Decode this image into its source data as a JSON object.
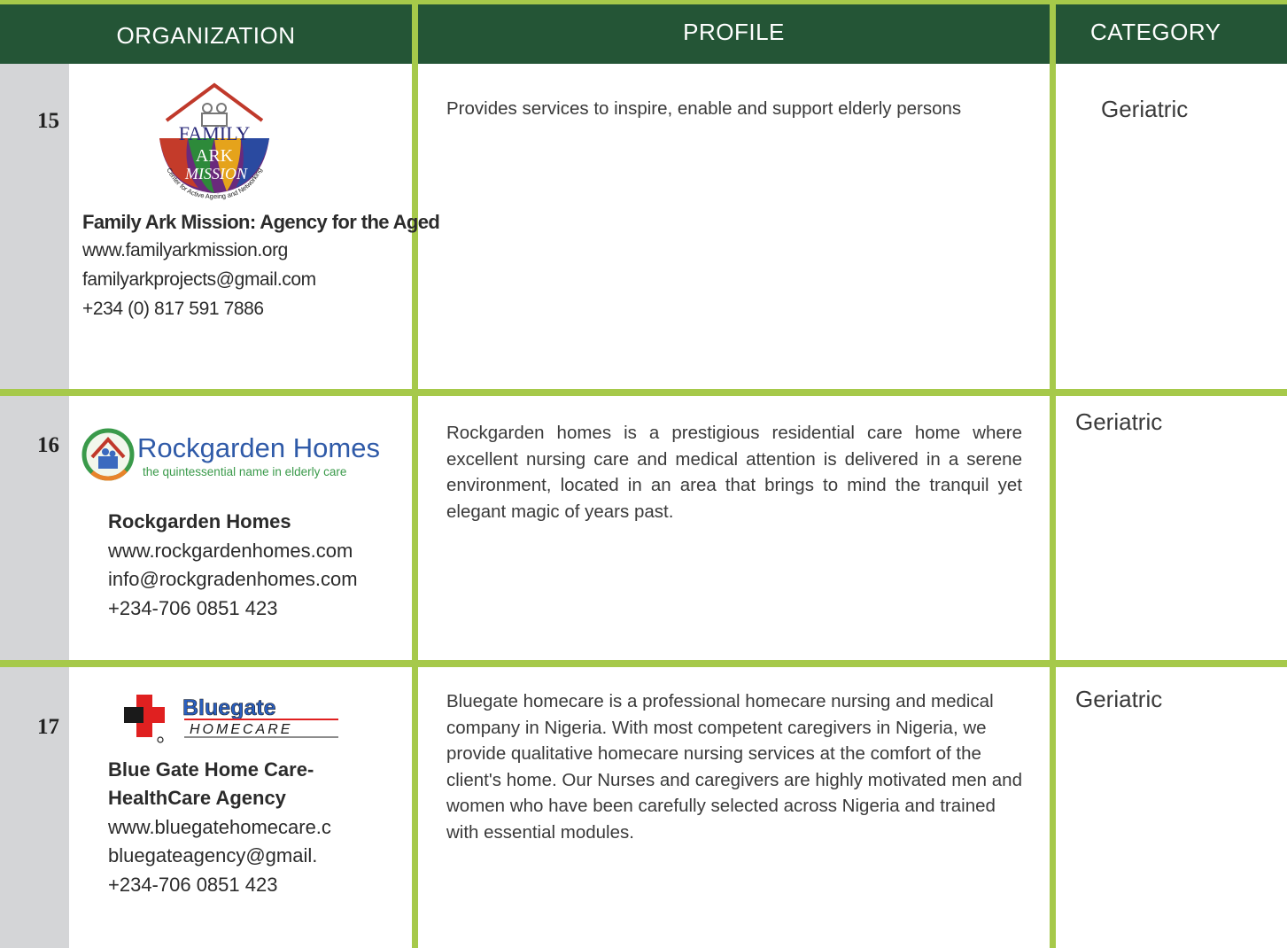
{
  "header": {
    "organization": "ORGANIZATION",
    "profile": "PROFILE",
    "category": "CATEGORY"
  },
  "rows": [
    {
      "number": "15",
      "logo": {
        "icon": "family-ark-mission-logo",
        "line1": "FAMILY",
        "line2": "ARK",
        "line3": "MISSION",
        "arc_text": "Center for Active Ageing and Networking"
      },
      "name": "Family Ark Mission: Agency for the Aged",
      "website": "www.familyarkmission.org",
      "email": "familyarkprojects@gmail.com",
      "phone": "+234 (0) 817 591 7886",
      "profile": "Provides services to inspire, enable and support elderly persons",
      "category": "Geriatric"
    },
    {
      "number": "16",
      "logo": {
        "icon": "rockgarden-homes-logo",
        "title": "Rockgarden Homes",
        "tagline": "the quintessential name in elderly care"
      },
      "name": "Rockgarden Homes",
      "website": "www.rockgardenhomes.com",
      "email": "info@rockgradenhomes.com",
      "phone": "+234-706 0851 423",
      "profile": "Rockgarden homes is a prestigious residential care home where excellent nursing care and medical attention is delivered in a serene environment, located in an area that brings to mind the tranquil yet elegant magic of years past.",
      "category": "Geriatric"
    },
    {
      "number": "17",
      "logo": {
        "icon": "bluegate-homecare-logo",
        "title": "Bluegate",
        "subtitle": "HOMECARE"
      },
      "name_line1": "Blue Gate Home Care-",
      "name_line2": "HealthCare Agency",
      "website": "www.bluegatehomecare.c",
      "email": "bluegateagency@gmail.",
      "phone": "+234-706 0851 423",
      "profile": "Bluegate homecare is a professional homecare nursing and medical company in Nigeria. With most competent caregivers in Nigeria, we provide qualitative homecare nursing services at the comfort of the client's home. Our Nurses and caregivers are highly motivated men and women who have been carefully selected across Nigeria and trained with essential modules.",
      "category": "Geriatric"
    }
  ],
  "colors": {
    "header_bg": "#245536",
    "grid_line": "#a6c94a",
    "number_column": "#d4d5d7"
  }
}
